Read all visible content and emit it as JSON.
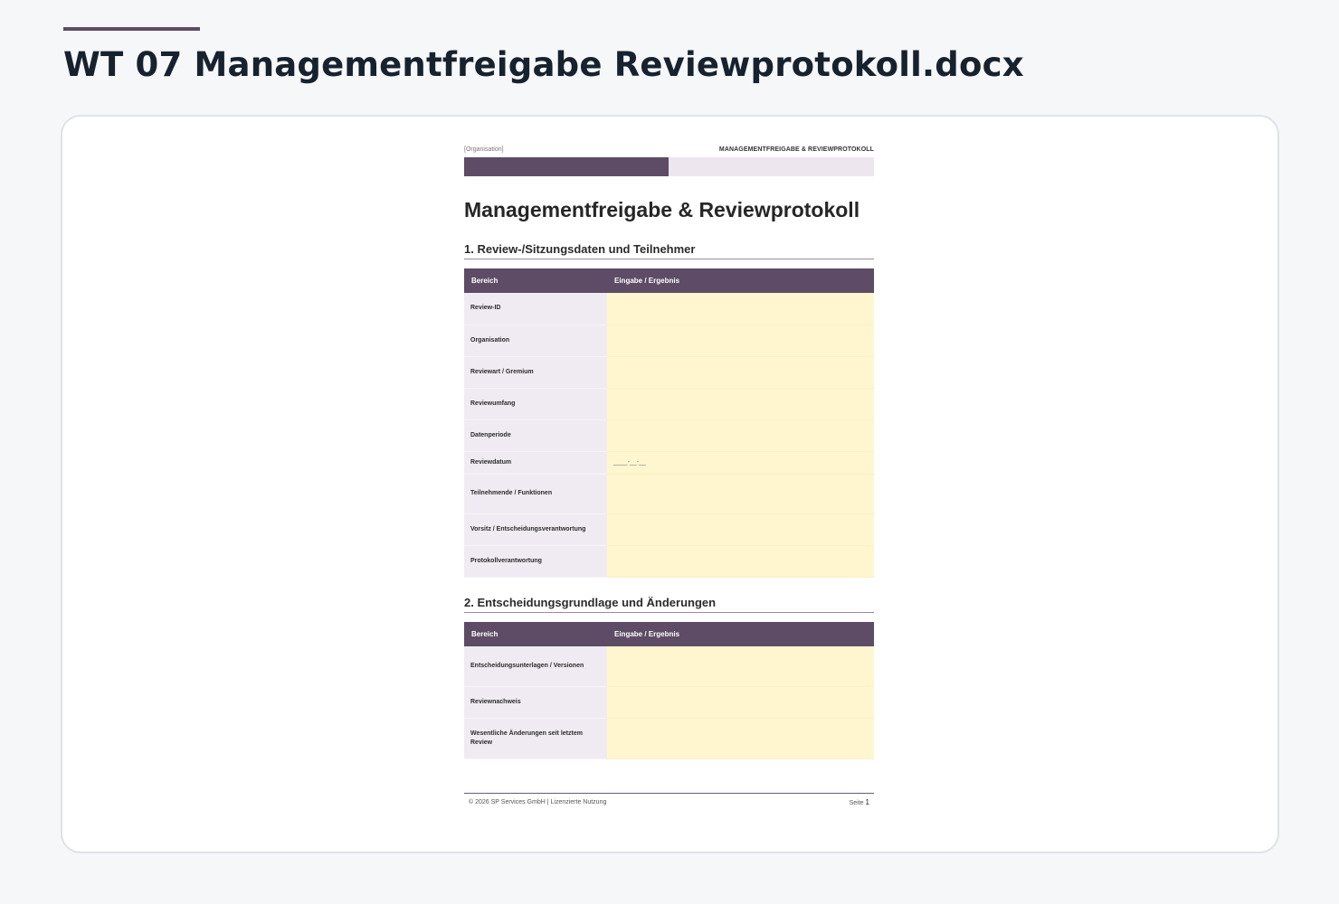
{
  "file": {
    "title": "WT 07 Managementfreigabe Reviewprotokoll.docx"
  },
  "doc": {
    "header_org": "[Organisation]",
    "header_title": "MANAGEMENTFREIGABE & REVIEWPROTOKOLL",
    "title": "Managementfreigabe & Reviewprotokoll",
    "section1": {
      "title": "1. Review-/Sitzungsdaten und Teilnehmer",
      "col1": "Bereich",
      "col2": "Eingabe / Ergebnis",
      "rows": [
        {
          "label": "Review-ID",
          "value": ""
        },
        {
          "label": "Organisation",
          "value": ""
        },
        {
          "label": "Reviewart / Gremium",
          "value": ""
        },
        {
          "label": "Reviewumfang",
          "value": ""
        },
        {
          "label": "Datenperiode",
          "value": ""
        },
        {
          "label": "Reviewdatum",
          "value": "____-__-__"
        },
        {
          "label": "Teilnehmende / Funktionen",
          "value": ""
        },
        {
          "label": "Vorsitz / Entscheidungsverantwortung",
          "value": ""
        },
        {
          "label": "Protokollverantwortung",
          "value": ""
        }
      ]
    },
    "section2": {
      "title": "2. Entscheidungsgrundlage und Änderungen",
      "col1": "Bereich",
      "col2": "Eingabe / Ergebnis",
      "rows": [
        {
          "label": "Entscheidungsunterlagen / Versionen",
          "value": ""
        },
        {
          "label": "Reviewnachweis",
          "value": ""
        },
        {
          "label": "Wesentliche Änderungen seit letztem Review",
          "value": ""
        }
      ]
    },
    "footer": {
      "copyright": "© 2026 SP Services GmbH | Lizenzierte Nutzung",
      "page_label": "Seite",
      "page_number": "1"
    }
  }
}
